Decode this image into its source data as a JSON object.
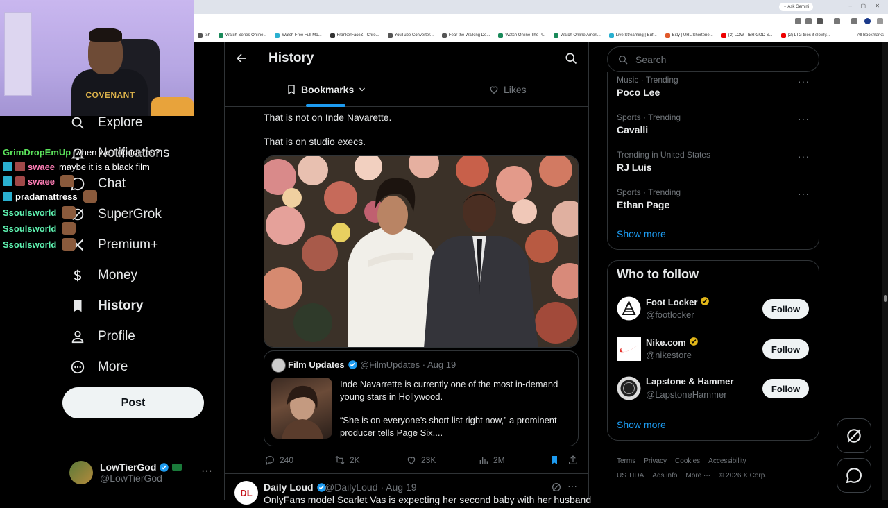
{
  "browser": {
    "ask_gemini": "Ask Gemini",
    "bookmarks": [
      {
        "label": "tch",
        "color": "#555"
      },
      {
        "label": "Watch Series Online...",
        "color": "#1a8a5a"
      },
      {
        "label": "Watch Free Full Mo...",
        "color": "#2ab0d0"
      },
      {
        "label": "FrankerFaceZ - Chro...",
        "color": "#333"
      },
      {
        "label": "YouTube Converter...",
        "color": "#555"
      },
      {
        "label": "Fear the Walking De...",
        "color": "#555"
      },
      {
        "label": "Watch Online The P...",
        "color": "#1a8a5a"
      },
      {
        "label": "Watch Online Ameri...",
        "color": "#1a8a5a"
      },
      {
        "label": "Live Streaming | Buf...",
        "color": "#2ab0d0"
      },
      {
        "label": "Bitly | URL Shortene...",
        "color": "#e0592a"
      },
      {
        "label": "(2) LOW TIER GOD S...",
        "color": "#e00"
      },
      {
        "label": "(2) LTG tries it slowly...",
        "color": "#e00"
      }
    ],
    "all_bookmarks": "All Bookmarks"
  },
  "webcam": {
    "shirt_text": "COVENANT"
  },
  "chat": [
    {
      "user": "GrimDropEmUp",
      "user_color": "#5be35b",
      "message": "when we flop tdems?",
      "badges": 0
    },
    {
      "user": "swaee",
      "user_color": "#ff7eb6",
      "message": "maybe it is a black film",
      "badges": 2
    },
    {
      "user": "swaee",
      "user_color": "#ff7eb6",
      "message": "",
      "badges": 2
    },
    {
      "user": "pradamattress",
      "user_color": "#ffffff",
      "message": "",
      "badges": 1
    },
    {
      "user": "Ssoulsworld",
      "user_color": "#5ef2b0",
      "message": "",
      "badges": 0
    },
    {
      "user": "Ssoulsworld",
      "user_color": "#5ef2b0",
      "message": "",
      "badges": 0
    },
    {
      "user": "Ssoulsworld",
      "user_color": "#5ef2b0",
      "message": "",
      "badges": 0
    }
  ],
  "nav": {
    "items": [
      {
        "label": "Explore",
        "icon": "search-icon"
      },
      {
        "label": "Notifications",
        "icon": "bell-icon"
      },
      {
        "label": "Chat",
        "icon": "chat-icon"
      },
      {
        "label": "SuperGrok",
        "icon": "grok-icon"
      },
      {
        "label": "Premium+",
        "icon": "x-icon"
      },
      {
        "label": "Money",
        "icon": "money-icon"
      },
      {
        "label": "History",
        "icon": "bookmark-icon"
      },
      {
        "label": "Profile",
        "icon": "profile-icon"
      },
      {
        "label": "More",
        "icon": "more-icon"
      }
    ],
    "active": "History",
    "post_label": "Post"
  },
  "account": {
    "name": "LowTierGod",
    "handle": "@LowTierGod",
    "more": "···"
  },
  "header": {
    "title": "History",
    "tabs": [
      {
        "label": "Bookmarks",
        "active": true
      },
      {
        "label": "Likes",
        "active": false
      }
    ]
  },
  "tweet": {
    "text_line1": "That is not on Inde Navarette.",
    "text_line2": "That is on studio execs.",
    "quote": {
      "name": "Film Updates",
      "handle_time": "@FilmUpdates · Aug 19",
      "text1": "Inde Navarrette is currently one of the most in-demand young stars in Hollywood.",
      "text2": "“She is on everyone’s short list right now,” a prominent producer tells Page Six...."
    },
    "actions": {
      "replies": "240",
      "reposts": "2K",
      "likes": "23K",
      "views": "2M"
    }
  },
  "next_tweet": {
    "name": "Daily Loud",
    "handle_time": "@DailyLoud · Aug 19",
    "text": "OnlyFans model Scarlet Vas is expecting her second baby with her husband"
  },
  "sidebar": {
    "search_placeholder": "Search",
    "trends": [
      {
        "meta": "Music · Trending",
        "title": "Poco Lee"
      },
      {
        "meta": "Sports · Trending",
        "title": "Cavalli"
      },
      {
        "meta": "Trending in United States",
        "title": "RJ Luis"
      },
      {
        "meta": "Sports · Trending",
        "title": "Ethan Page"
      }
    ],
    "show_more": "Show more",
    "who_to_follow_title": "Who to follow",
    "follow": [
      {
        "name": "Foot Locker",
        "handle": "@footlocker"
      },
      {
        "name": "Nike.com",
        "handle": "@nikestore"
      },
      {
        "name": "Lapstone & Hammer",
        "handle": "@LapstoneHammer"
      }
    ],
    "follow_label": "Follow",
    "show_more_2": "Show more",
    "footer_row1": [
      "Terms",
      "Privacy",
      "Cookies",
      "Accessibility"
    ],
    "footer_row2": [
      "US TIDA",
      "Ads info",
      "More ···",
      "© 2026 X Corp."
    ]
  },
  "colors": {
    "accent": "#1d9bf0",
    "verified_gold": "#e2b719",
    "background": "#000000"
  }
}
